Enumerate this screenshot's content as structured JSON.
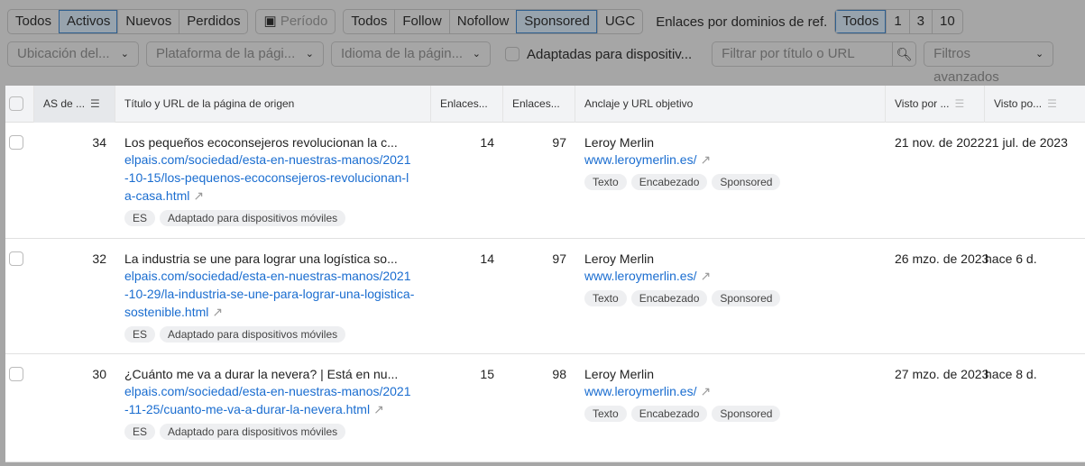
{
  "filters": {
    "status": [
      {
        "label": "Todos",
        "selected": false
      },
      {
        "label": "Activos",
        "selected": true
      },
      {
        "label": "Nuevos",
        "selected": false
      },
      {
        "label": "Perdidos",
        "selected": false
      }
    ],
    "period": "Período",
    "link_type": [
      {
        "label": "Todos",
        "selected": false
      },
      {
        "label": "Follow",
        "selected": false
      },
      {
        "label": "Nofollow",
        "selected": false
      },
      {
        "label": "Sponsored",
        "selected": true
      },
      {
        "label": "UGC",
        "selected": false
      }
    ],
    "per_domain_label": "Enlaces por dominios de ref.",
    "per_domain": [
      {
        "label": "Todos",
        "selected": true
      },
      {
        "label": "1",
        "selected": false
      },
      {
        "label": "3",
        "selected": false
      },
      {
        "label": "10",
        "selected": false
      }
    ],
    "location": "Ubicación del...",
    "platform": "Plataforma de la pági...",
    "language": "Idioma de la págin...",
    "mobile_label": "Adaptadas para dispositiv...",
    "search_placeholder": "Filtrar por título o URL",
    "advanced": "Filtros avanzados"
  },
  "table": {
    "headers": [
      "AS de ...",
      "Título y URL de la página de origen",
      "Enlaces...",
      "Enlaces...",
      "Anclaje y URL objetivo",
      "Visto por ...",
      "Visto po..."
    ],
    "rows": [
      {
        "as": "34",
        "title": "Los pequeños ecoconsejeros revolucionan la c...",
        "url": "elpais.com/sociedad/esta-en-nuestras-manos/2021-10-15/los-pequenos-ecoconsejeros-revolucionan-la-casa.html",
        "lang": "ES",
        "mobile": "Adaptado para dispositivos móviles",
        "links1": "14",
        "links2": "97",
        "anchor": "Leroy Merlin",
        "target": "www.leroymerlin.es/",
        "tags": [
          "Texto",
          "Encabezado",
          "Sponsored"
        ],
        "first_seen": "21 nov. de 2022",
        "last_seen": "21 jul. de 2023"
      },
      {
        "as": "32",
        "title": "La industria se une para lograr una logística so...",
        "url": "elpais.com/sociedad/esta-en-nuestras-manos/2021-10-29/la-industria-se-une-para-lograr-una-logistica-sostenible.html",
        "lang": "ES",
        "mobile": "Adaptado para dispositivos móviles",
        "links1": "14",
        "links2": "97",
        "anchor": "Leroy Merlin",
        "target": "www.leroymerlin.es/",
        "tags": [
          "Texto",
          "Encabezado",
          "Sponsored"
        ],
        "first_seen": "26 mzo. de 2023",
        "last_seen": "hace 6 d."
      },
      {
        "as": "30",
        "title": "¿Cuánto me va a durar la nevera? | Está en nu...",
        "url": "elpais.com/sociedad/esta-en-nuestras-manos/2021-11-25/cuanto-me-va-a-durar-la-nevera.html",
        "lang": "ES",
        "mobile": "Adaptado para dispositivos móviles",
        "links1": "15",
        "links2": "98",
        "anchor": "Leroy Merlin",
        "target": "www.leroymerlin.es/",
        "tags": [
          "Texto",
          "Encabezado",
          "Sponsored"
        ],
        "first_seen": "27 mzo. de 2023",
        "last_seen": "hace 8 d."
      }
    ]
  }
}
